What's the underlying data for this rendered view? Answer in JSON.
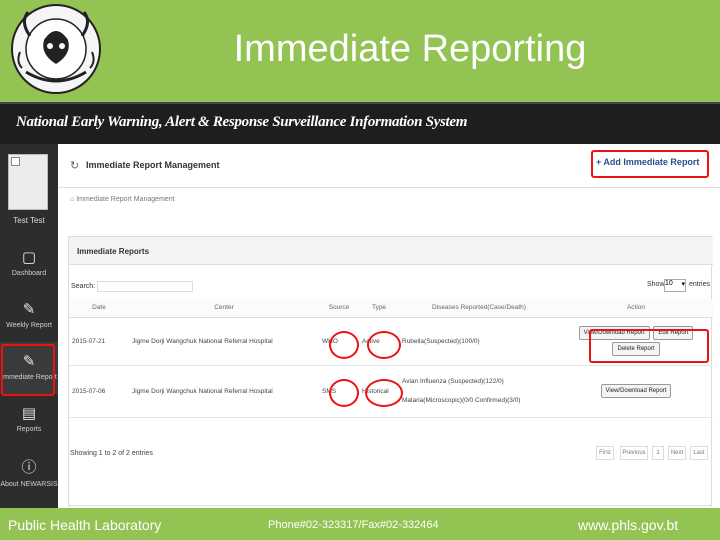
{
  "slide": {
    "title": "Immediate Reporting",
    "logo_icon": "emblem-seal-icon"
  },
  "app": {
    "title": "National Early Warning, Alert & Response Surveillance Information System",
    "bar_color": "#1e1e1e"
  },
  "sidebar": {
    "user_name": "Test Test",
    "items": [
      {
        "label": "Dashboard",
        "icon": "monitor-icon"
      },
      {
        "label": "Weekly Report",
        "icon": "edit-icon"
      },
      {
        "label": "Immediate Report",
        "icon": "edit-icon",
        "active": true
      },
      {
        "label": "Reports",
        "icon": "bar-chart-icon"
      },
      {
        "label": "About NEWARSIS",
        "icon": "info-icon"
      }
    ]
  },
  "page": {
    "title": "Immediate Report Management",
    "add_button": "+ Add Immediate Report",
    "breadcrumb": "Immediate Report Management"
  },
  "panel": {
    "title": "Immediate Reports",
    "search_label": "Search:",
    "search_value": "",
    "show_label": "Show",
    "page_size": "10",
    "entries_label": "entries",
    "columns": [
      "Date",
      "Center",
      "Source",
      "Type",
      "Diseases Reported(Case/Death)",
      "Action"
    ],
    "rows": [
      {
        "date": "2015-07-21",
        "center": "Jigme Dorji Wangchuk National Referral Hospital",
        "source": "WHO",
        "type": "Active",
        "diseases": [
          "Rubella(Suspected)(100/0)"
        ],
        "actions": [
          "View/Download Report",
          "Edit Report",
          "Delete Report"
        ]
      },
      {
        "date": "2015-07-06",
        "center": "Jigme Dorji Wangchuk National Referral Hospital",
        "source": "SMS",
        "type": "Historical",
        "diseases": [
          "Avian Influenza (Suspected)(122/0)",
          "Malaria(Microscopic)(0/0 Confirmed)(3/0)"
        ],
        "actions": [
          "View/Download Report"
        ]
      }
    ],
    "showing": "Showing 1 to 2 of 2 entries",
    "pagination": [
      "First",
      "Previous",
      "1",
      "Next",
      "Last"
    ]
  },
  "footer": {
    "left": "Public Health Laboratory",
    "middle": "Phone#02-323317/Fax#02-332464",
    "right": "www.phls.gov.bt"
  },
  "colors": {
    "slide_bg": "#92c353",
    "highlight": "#e11111",
    "link": "#2a4e8c"
  }
}
